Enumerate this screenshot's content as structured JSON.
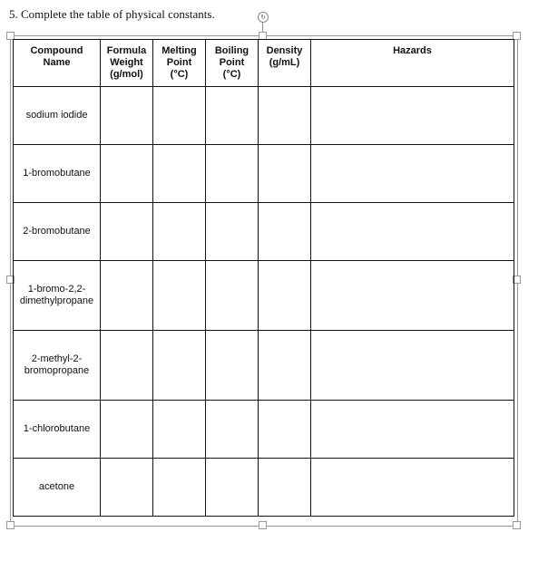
{
  "question": "5. Complete the table of physical constants.",
  "rotate_icon": "rotate-icon",
  "table": {
    "headers": [
      [
        "Compound",
        "Name"
      ],
      [
        "Formula",
        "Weight",
        "(g/mol)"
      ],
      [
        "Melting",
        "Point",
        "(°C)"
      ],
      [
        "Boiling",
        "Point",
        "(°C)"
      ],
      [
        "Density",
        "(g/mL)"
      ],
      [
        "Hazards"
      ]
    ],
    "rows": [
      {
        "compound": [
          "sodium iodide"
        ],
        "formula_weight": "",
        "melting_point": "",
        "boiling_point": "",
        "density": "",
        "hazards": ""
      },
      {
        "compound": [
          "1-bromobutane"
        ],
        "formula_weight": "",
        "melting_point": "",
        "boiling_point": "",
        "density": "",
        "hazards": ""
      },
      {
        "compound": [
          "2-bromobutane"
        ],
        "formula_weight": "",
        "melting_point": "",
        "boiling_point": "",
        "density": "",
        "hazards": ""
      },
      {
        "compound": [
          "1-bromo-2,2-",
          "dimethylpropane"
        ],
        "formula_weight": "",
        "melting_point": "",
        "boiling_point": "",
        "density": "",
        "hazards": ""
      },
      {
        "compound": [
          "2-methyl-2-",
          "bromopropane"
        ],
        "formula_weight": "",
        "melting_point": "",
        "boiling_point": "",
        "density": "",
        "hazards": ""
      },
      {
        "compound": [
          "1-chlorobutane"
        ],
        "formula_weight": "",
        "melting_point": "",
        "boiling_point": "",
        "density": "",
        "hazards": ""
      },
      {
        "compound": [
          "acetone"
        ],
        "formula_weight": "",
        "melting_point": "",
        "boiling_point": "",
        "density": "",
        "hazards": ""
      }
    ]
  }
}
